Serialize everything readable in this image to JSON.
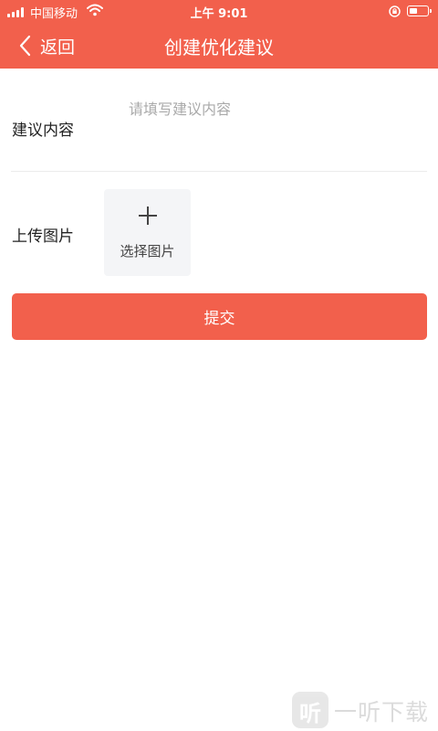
{
  "status_bar": {
    "carrier": "中国移动",
    "time": "上午 9:01"
  },
  "header": {
    "back_label": "返回",
    "title": "创建优化建议"
  },
  "form": {
    "content_label": "建议内容",
    "content_placeholder": "请填写建议内容",
    "content_value": "",
    "upload_label": "上传图片",
    "upload_button_label": "选择图片",
    "submit_label": "提交"
  },
  "watermark": {
    "glyph": "听",
    "text": "一听下载"
  },
  "colors": {
    "primary": "#f2604c",
    "uploader_bg": "#f4f5f7",
    "placeholder": "#aaaaaa"
  }
}
